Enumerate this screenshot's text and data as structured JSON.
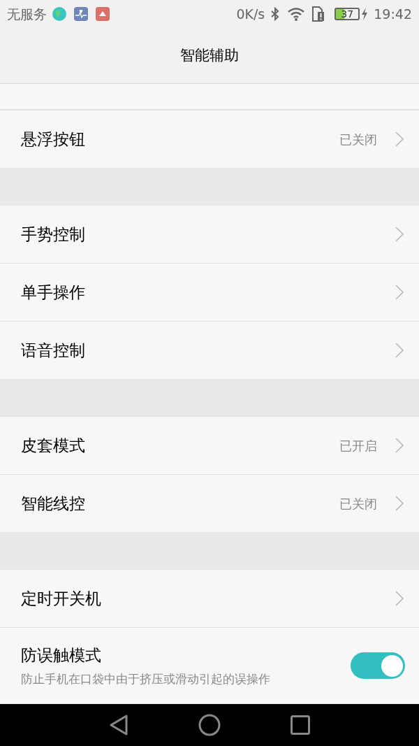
{
  "status_bar": {
    "carrier": "无服务",
    "speed": "0K/s",
    "battery": "37",
    "time": "19:42"
  },
  "title": "智能辅助",
  "groups": [
    {
      "items": [
        {
          "kind": "link",
          "label": "悬浮按钮",
          "value": "已关闭"
        }
      ]
    },
    {
      "items": [
        {
          "kind": "link",
          "label": "手势控制"
        },
        {
          "kind": "link",
          "label": "单手操作"
        },
        {
          "kind": "link",
          "label": "语音控制"
        }
      ]
    },
    {
      "items": [
        {
          "kind": "link",
          "label": "皮套模式",
          "value": "已开启"
        },
        {
          "kind": "link",
          "label": "智能线控",
          "value": "已关闭"
        }
      ]
    },
    {
      "items": [
        {
          "kind": "link",
          "label": "定时开关机"
        },
        {
          "kind": "toggle",
          "label": "防误触模式",
          "description": "防止手机在口袋中由于挤压或滑动引起的误操作",
          "on": true
        }
      ]
    }
  ]
}
